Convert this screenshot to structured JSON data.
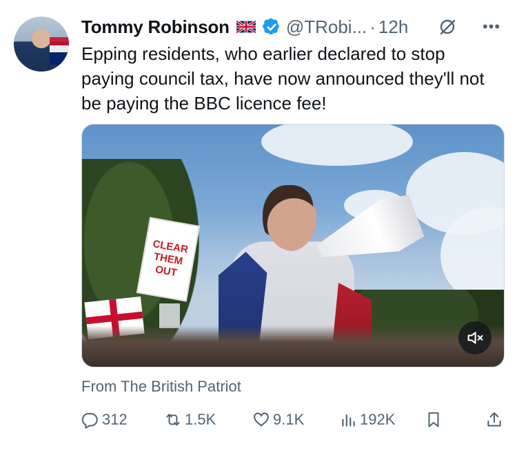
{
  "tweet": {
    "author_name": "Tommy Robinson",
    "handle": "@TRobi...",
    "separator": "·",
    "time": "12h",
    "text": "Epping residents, who earlier declared to stop paying council tax, have now announced they'll not be paying the BBC licence fee!",
    "source": "From The British Patriot"
  },
  "media": {
    "sign_text": "CLEAR THEM OUT",
    "mute_icon": "volume-mute-icon"
  },
  "actions": {
    "replies": "312",
    "reposts": "1.5K",
    "likes": "9.1K",
    "views": "192K"
  },
  "icons": {
    "verified": "verified-badge-icon",
    "flag": "uk-flag-icon",
    "grok": "grok-icon",
    "more": "more-icon",
    "reply": "reply-icon",
    "repost": "repost-icon",
    "like": "like-icon",
    "views": "views-icon",
    "bookmark": "bookmark-icon",
    "share": "share-icon"
  },
  "colors": {
    "text": "#0f1419",
    "muted": "#536471",
    "verified_blue": "#1d9bf0"
  }
}
